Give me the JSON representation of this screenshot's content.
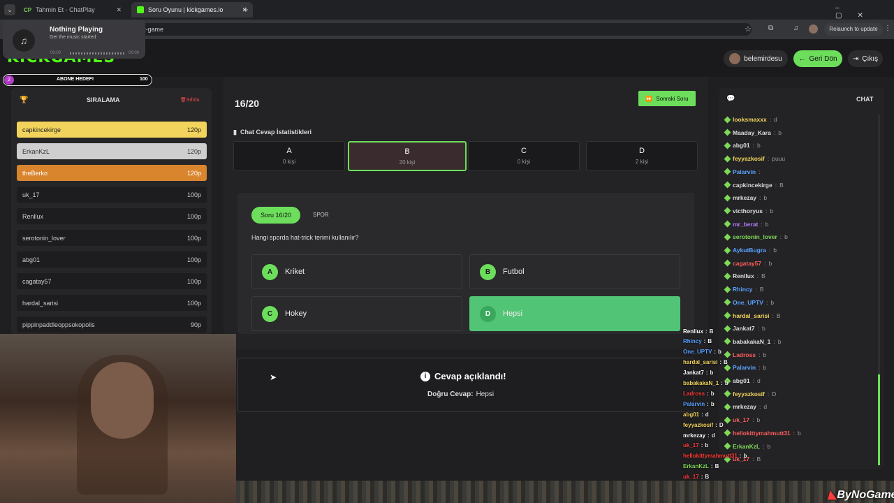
{
  "browser": {
    "tabs": [
      {
        "label": "Tahmin Et - ChatPlay",
        "favicon": "CP"
      },
      {
        "label": "Soru Oyunu | kickgames.io"
      }
    ],
    "url_fragment": "t-game",
    "relaunch_label": "Relaunch to update"
  },
  "media": {
    "title": "Nothing Playing",
    "subtitle": "Get the music started",
    "time_start": "00:00",
    "time_end": "00:00"
  },
  "header": {
    "logo": "KICKGAMES",
    "user": "belemirdesu",
    "back_label": "Geri Dön",
    "logout_label": "Çıkış"
  },
  "sub_goal": {
    "count": "2",
    "label": "ABONE HEDEFI",
    "target": "100"
  },
  "ranking": {
    "title": "SIRALAMA",
    "reset_label": "Sıfırla",
    "rows": [
      {
        "name": "capkincekirge",
        "score": "120p"
      },
      {
        "name": "ErkanKzL",
        "score": "120p"
      },
      {
        "name": "theBerko",
        "score": "120p"
      },
      {
        "name": "uk_17",
        "score": "100p"
      },
      {
        "name": "Renllux",
        "score": "100p"
      },
      {
        "name": "serotonin_lover",
        "score": "100p"
      },
      {
        "name": "abg01",
        "score": "100p"
      },
      {
        "name": "cagatay57",
        "score": "100p"
      },
      {
        "name": "hardal_sarisi",
        "score": "100p"
      },
      {
        "name": "pippinpaddleoppsokopolis",
        "score": "90p"
      }
    ]
  },
  "game": {
    "progress": "16/20",
    "next_label": "Sonraki Soru",
    "stats_title": "Chat Cevap İstatistikleri",
    "stats": [
      {
        "letter": "A",
        "count": "0 kişi"
      },
      {
        "letter": "B",
        "count": "20 kişi"
      },
      {
        "letter": "C",
        "count": "0 kişi"
      },
      {
        "letter": "D",
        "count": "2 kişi"
      }
    ],
    "question_badge": "Soru 16/20",
    "category": "SPOR",
    "question": "Hangi sporda hat-trick terimi kullanılır?",
    "options": [
      {
        "letter": "A",
        "text": "Kriket"
      },
      {
        "letter": "B",
        "text": "Futbol"
      },
      {
        "letter": "C",
        "text": "Hokey"
      },
      {
        "letter": "D",
        "text": "Hepsi"
      }
    ],
    "reveal_title": "Cevap açıklandı!",
    "reveal_label": "Doğru Cevap:",
    "reveal_answer": "Hepsi"
  },
  "chat": {
    "title": "CHAT",
    "messages": [
      {
        "user": "looksmaxxx",
        "msg": "d",
        "color": "#f2d45c"
      },
      {
        "user": "Maaday_Kara",
        "msg": "b",
        "color": "#dddddd"
      },
      {
        "user": "abg01",
        "msg": "b",
        "color": "#dddddd"
      },
      {
        "user": "feyyazkosif",
        "msg": "puuu",
        "color": "#f2d45c"
      },
      {
        "user": "Palarvin",
        "msg": "",
        "color": "#5aa0ff"
      },
      {
        "user": "capkincekirge",
        "msg": "B",
        "color": "#dddddd"
      },
      {
        "user": "mrkezay",
        "msg": "b",
        "color": "#dddddd"
      },
      {
        "user": "victhoryus",
        "msg": "b",
        "color": "#dddddd"
      },
      {
        "user": "mr_berat",
        "msg": "b",
        "color": "#b57bff"
      },
      {
        "user": "serotonin_lover",
        "msg": "b",
        "color": "#7ed957"
      },
      {
        "user": "AykutBugra",
        "msg": "b",
        "color": "#5aa0ff"
      },
      {
        "user": "cagatay57",
        "msg": "b",
        "color": "#ff5c5c"
      },
      {
        "user": "Renllux",
        "msg": "B",
        "color": "#dddddd"
      },
      {
        "user": "Rhincy",
        "msg": "B",
        "color": "#5aa0ff"
      },
      {
        "user": "One_UPTV",
        "msg": "b",
        "color": "#5aa0ff"
      },
      {
        "user": "hardal_sarisi",
        "msg": "B",
        "color": "#f2d45c"
      },
      {
        "user": "Jankat7",
        "msg": "b",
        "color": "#dddddd"
      },
      {
        "user": "babakakaN_1",
        "msg": "b",
        "color": "#dddddd"
      },
      {
        "user": "Ladross",
        "msg": "b",
        "color": "#ff5c5c"
      },
      {
        "user": "Palarvin",
        "msg": "b",
        "color": "#5aa0ff"
      },
      {
        "user": "abg01",
        "msg": "d",
        "color": "#dddddd"
      },
      {
        "user": "feyyazkosif",
        "msg": "D",
        "color": "#f2d45c"
      },
      {
        "user": "mrkezay",
        "msg": "d",
        "color": "#dddddd"
      },
      {
        "user": "uk_17",
        "msg": "b",
        "color": "#ff5c5c"
      },
      {
        "user": "hellokittymahmutt31",
        "msg": "b",
        "color": "#ff5c5c"
      },
      {
        "user": "ErkanKzL",
        "msg": "b",
        "color": "#7ed957"
      },
      {
        "user": "uk_17",
        "msg": "B",
        "color": "#ff5c5c"
      }
    ]
  },
  "overlay_chat": [
    {
      "user": "Renllux",
      "msg": "B",
      "color": "#ffffff"
    },
    {
      "user": "Rhincy",
      "msg": "B",
      "color": "#5aa0ff"
    },
    {
      "user": "One_UPTV",
      "msg": "b",
      "color": "#5aa0ff"
    },
    {
      "user": "hardal_sarisi",
      "msg": "B",
      "color": "#f2d45c"
    },
    {
      "user": "Jankat7",
      "msg": "b",
      "color": "#ffffff"
    },
    {
      "user": "babakakaN_1",
      "msg": "b",
      "color": "#f2d45c"
    },
    {
      "user": "Ladross",
      "msg": "b",
      "color": "#ff3b3b"
    },
    {
      "user": "Palarvin",
      "msg": "b",
      "color": "#5aa0ff"
    },
    {
      "user": "abg01",
      "msg": "d",
      "color": "#f2d45c"
    },
    {
      "user": "feyyazkosif",
      "msg": "D",
      "color": "#f2d45c"
    },
    {
      "user": "mrkezay",
      "msg": "d",
      "color": "#ffffff"
    },
    {
      "user": "uk_17",
      "msg": "b",
      "color": "#ff3b3b"
    },
    {
      "user": "hellokittymahmutt31",
      "msg": "b",
      "color": "#ff3b3b"
    },
    {
      "user": "ErkanKzL",
      "msg": "B",
      "color": "#7ed957"
    },
    {
      "user": "uk_17",
      "msg": "B",
      "color": "#ff3b3b"
    }
  ],
  "watermark": "ByNoGame",
  "colors": {
    "accent": "#6dde5c",
    "gold": "#f2d45c",
    "silver": "#cfcfcf",
    "bronze": "#d9852e"
  }
}
